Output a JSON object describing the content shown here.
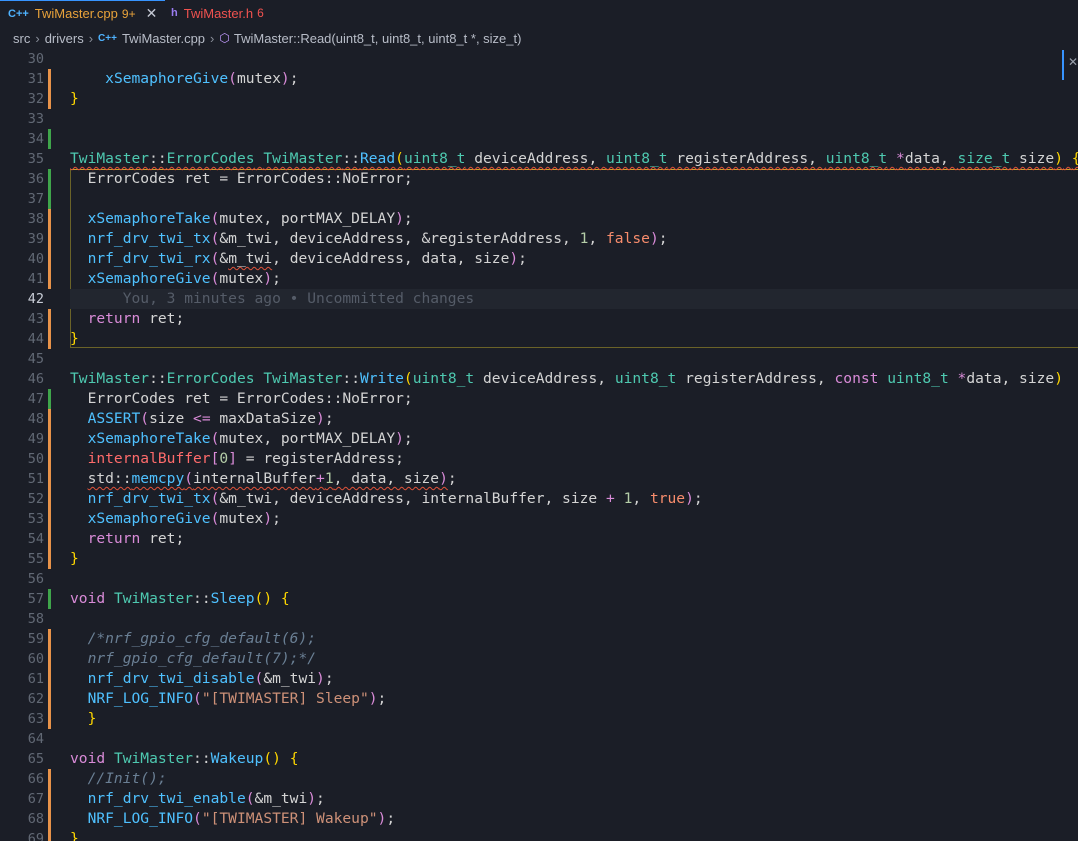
{
  "tabs": [
    {
      "icon": "C++",
      "name": "TwiMaster.cpp",
      "badge": "9+",
      "active": true,
      "close": "✕"
    },
    {
      "icon": "h",
      "name": "TwiMaster.h",
      "badge": "6",
      "active": false
    }
  ],
  "breadcrumb": {
    "parts": [
      "src",
      "drivers"
    ],
    "file_icon": "C++",
    "file": "TwiMaster.cpp",
    "symbol": "TwiMaster::Read(uint8_t, uint8_t, uint8_t *, size_t)"
  },
  "blame": "You, 3 minutes ago • Uncommitted changes",
  "colors": {
    "modified": "#e8934a",
    "added": "#3fa54b",
    "accent": "#3794ff"
  },
  "lines": [
    {
      "n": "30",
      "g": "",
      "html": ""
    },
    {
      "n": "31",
      "g": "mod",
      "html": "    <span class='f'>xSemaphoreGive</span><span class='b2'>(</span>mutex<span class='b2'>)</span>;"
    },
    {
      "n": "32",
      "g": "mod",
      "html": "<span class='p'>}</span>"
    },
    {
      "n": "33",
      "g": "",
      "html": ""
    },
    {
      "n": "34",
      "g": "add",
      "html": ""
    },
    {
      "n": "35",
      "g": "",
      "html": "<span class='squig'><span class='t'>TwiMaster</span><span class='o'>::</span><span class='t'>ErrorCodes</span> <span class='t'>TwiMaster</span><span class='o'>::</span><span class='f'>Read</span><span class='p'>(</span><span class='t'>uint8_t</span> deviceAddress, <span class='t'>uint8_t</span> registerAddress, <span class='t'>uint8_t</span> <span class='k'>*</span>data, <span class='t'>size_t</span> size<span class='p'>)</span> <span class='p'>{</span></span>"
    },
    {
      "n": "36",
      "g": "add",
      "html": "  ErrorCodes ret = ErrorCodes::NoError;"
    },
    {
      "n": "37",
      "g": "add",
      "html": ""
    },
    {
      "n": "38",
      "g": "mod",
      "html": "  <span class='f'>xSemaphoreTake</span><span class='b2'>(</span>mutex, portMAX_DELAY<span class='b2'>)</span>;"
    },
    {
      "n": "39",
      "g": "mod",
      "html": "  <span class='f'>nrf_drv_twi_tx</span><span class='b2'>(</span>&amp;m_twi, deviceAddress, &amp;registerAddress, <span class='n'>1</span>, <span class='bool'>false</span><span class='b2'>)</span>;"
    },
    {
      "n": "40",
      "g": "mod",
      "html": "  <span class='f'>nrf_drv_twi_rx</span><span class='b2'>(</span>&amp;<span class='squig'>m_twi</span>, deviceAddress, data, size<span class='b2'>)</span>;"
    },
    {
      "n": "41",
      "g": "mod",
      "html": "  <span class='f'>xSemaphoreGive</span><span class='b2'>(</span>mutex<span class='b2'>)</span>;"
    },
    {
      "n": "42",
      "g": "",
      "cur": true,
      "html": "      <span class='blame'>You, 3 minutes ago • Uncommitted changes</span>"
    },
    {
      "n": "43",
      "g": "mod",
      "html": "  <span class='k'>return</span> ret;"
    },
    {
      "n": "44",
      "g": "mod",
      "html": "<span class='p'>}</span>"
    },
    {
      "n": "45",
      "g": "",
      "html": ""
    },
    {
      "n": "46",
      "g": "",
      "html": "<span class='t'>TwiMaster</span><span class='o'>::</span><span class='t'>ErrorCodes</span> <span class='t'>TwiMaster</span><span class='o'>::</span><span class='f'>Write</span><span class='p'>(</span><span class='t'>uint8_t</span> deviceAddress, <span class='t'>uint8_t</span> registerAddress, <span class='k'>const</span> <span class='t'>uint8_t</span> <span class='k'>*</span>data, size<span class='p'>)</span>"
    },
    {
      "n": "47",
      "g": "add",
      "html": "  ErrorCodes ret = ErrorCodes::NoError;"
    },
    {
      "n": "48",
      "g": "mod",
      "html": "  <span class='f'>ASSERT</span><span class='b2'>(</span>size <span class='k'>&lt;=</span> maxDataSize<span class='b2'>)</span>;"
    },
    {
      "n": "49",
      "g": "mod",
      "html": "  <span class='f'>xSemaphoreTake</span><span class='b2'>(</span>mutex, portMAX_DELAY<span class='b2'>)</span>;"
    },
    {
      "n": "50",
      "g": "mod",
      "html": "  <span class='m'>internalBuffer</span><span class='b2'>[</span><span class='n'>0</span><span class='b2'>]</span> = registerAddress;"
    },
    {
      "n": "51",
      "g": "mod",
      "html": "  <span class='squig'>std::<span class='f'>memcpy</span><span class='b2'>(</span>internalBuffer<span class='k'>+</span><span class='n'>1</span>, data, size<span class='b2'>)</span></span>;"
    },
    {
      "n": "52",
      "g": "mod",
      "html": "  <span class='f'>nrf_drv_twi_tx</span><span class='b2'>(</span>&amp;m_twi, deviceAddress, internalBuffer, size <span class='k'>+</span> <span class='n'>1</span>, <span class='bool'>true</span><span class='b2'>)</span>;"
    },
    {
      "n": "53",
      "g": "mod",
      "html": "  <span class='f'>xSemaphoreGive</span><span class='b2'>(</span>mutex<span class='b2'>)</span>;"
    },
    {
      "n": "54",
      "g": "mod",
      "html": "  <span class='k'>return</span> ret;"
    },
    {
      "n": "55",
      "g": "mod",
      "html": "<span class='p'>}</span>"
    },
    {
      "n": "56",
      "g": "",
      "html": ""
    },
    {
      "n": "57",
      "g": "add",
      "html": "<span class='k'>void</span> <span class='t'>TwiMaster</span><span class='o'>::</span><span class='f'>Sleep</span><span class='p'>()</span> <span class='p'>{</span>"
    },
    {
      "n": "58",
      "g": "",
      "html": ""
    },
    {
      "n": "59",
      "g": "mod",
      "html": "  <span class='c'>/*nrf_gpio_cfg_default(6);</span>"
    },
    {
      "n": "60",
      "g": "mod",
      "html": "  <span class='c'>nrf_gpio_cfg_default(7);*/</span>"
    },
    {
      "n": "61",
      "g": "mod",
      "html": "  <span class='f'>nrf_drv_twi_disable</span><span class='b2'>(</span>&amp;m_twi<span class='b2'>)</span>;"
    },
    {
      "n": "62",
      "g": "mod",
      "html": "  <span class='f'>NRF_LOG_INFO</span><span class='b2'>(</span><span class='s'>\"[TWIMASTER] Sleep\"</span><span class='b2'>)</span>;"
    },
    {
      "n": "63",
      "g": "mod",
      "html": "  <span class='p'>}</span>"
    },
    {
      "n": "64",
      "g": "",
      "html": ""
    },
    {
      "n": "65",
      "g": "",
      "html": "<span class='k'>void</span> <span class='t'>TwiMaster</span><span class='o'>::</span><span class='f'>Wakeup</span><span class='p'>()</span> <span class='p'>{</span>"
    },
    {
      "n": "66",
      "g": "mod",
      "html": "  <span class='c'>//Init();</span>"
    },
    {
      "n": "67",
      "g": "mod",
      "html": "  <span class='f'>nrf_drv_twi_enable</span><span class='b2'>(</span>&amp;m_twi<span class='b2'>)</span>;"
    },
    {
      "n": "68",
      "g": "mod",
      "html": "  <span class='f'>NRF_LOG_INFO</span><span class='b2'>(</span><span class='s'>\"[TWIMASTER] Wakeup\"</span><span class='b2'>)</span>;"
    },
    {
      "n": "69",
      "g": "mod",
      "html": "<span class='p'>}</span>"
    }
  ]
}
